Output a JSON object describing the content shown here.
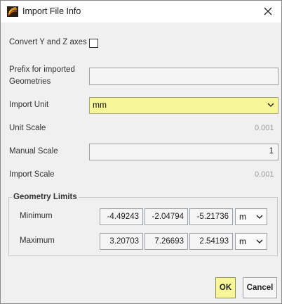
{
  "window": {
    "title": "Import File Info"
  },
  "form": {
    "convert_axes_label": "Convert Y and Z axes",
    "convert_axes_checked": false,
    "prefix_label_line1": "Prefix for imported",
    "prefix_label_line2": "Geometries",
    "prefix_value": "",
    "import_unit_label": "Import Unit",
    "import_unit_value": "mm",
    "unit_scale_label": "Unit Scale",
    "unit_scale_value": "0.001",
    "manual_scale_label": "Manual Scale",
    "manual_scale_value": "1",
    "import_scale_label": "Import Scale",
    "import_scale_value": "0.001"
  },
  "geometry_limits": {
    "title": "Geometry Limits",
    "minimum": {
      "label": "Minimum",
      "x": "-4.49243",
      "y": "-2.04794",
      "z": "-5.21736",
      "unit": "m"
    },
    "maximum": {
      "label": "Maximum",
      "x": "3.20703",
      "y": "7.26693",
      "z": "2.54193",
      "unit": "m"
    }
  },
  "buttons": {
    "ok": "OK",
    "cancel": "Cancel"
  },
  "colors": {
    "highlight": "#f7f79a",
    "background": "#f0f0f0"
  }
}
